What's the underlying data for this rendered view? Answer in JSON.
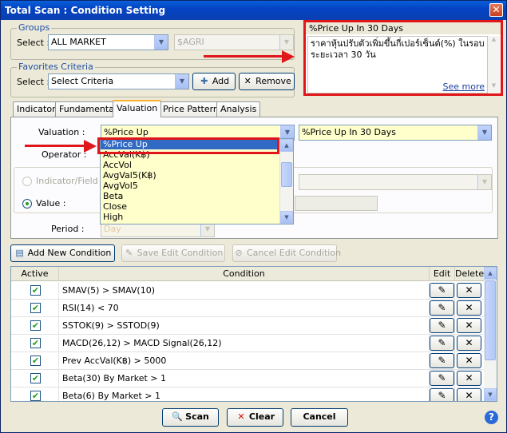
{
  "window": {
    "title": "Total Scan : Condition Setting",
    "close_glyph": "✕"
  },
  "groups": {
    "legend": "Groups",
    "select_label": "Select :",
    "market_value": "ALL MARKET",
    "sector_value": "$AGRI"
  },
  "favorites": {
    "legend": "Favorites Criteria",
    "select_label": "Select :",
    "criteria_value": "Select Criteria",
    "add_label": "Add",
    "remove_label": "Remove"
  },
  "description": {
    "title": "%Price Up In 30 Days",
    "text": "ราคาหุ้นปรับตัวเพิ่มขึ้นกี่เปอร์เซ็นต์(%) ในรอบระยะเวลา 30 วัน",
    "see_more": "See more"
  },
  "tabs": [
    "Indicator",
    "Fundamental",
    "Valuation",
    "Price Pattern",
    "Analysis"
  ],
  "valuation_panel": {
    "valuation_label": "Valuation :",
    "valuation_value": "%Price Up",
    "period_combo_value": "%Price Up In 30 Days",
    "operator_label": "Operator :",
    "indicator_field_label": "Indicator/Field :",
    "value_label": "Value :",
    "period_label": "Period :",
    "period_value": "Day",
    "dropdown_options": [
      "%Price Up",
      "AccVal(K฿)",
      "AccVol",
      "AvgVal5(K฿)",
      "AvgVol5",
      "Beta",
      "Close",
      "High"
    ],
    "selected_option": "%Price Up"
  },
  "actions": {
    "add_new_condition": "Add New Condition",
    "save_edit_condition": "Save Edit Condition",
    "cancel_edit_condition": "Cancel Edit Condition"
  },
  "grid": {
    "columns": [
      "Active",
      "Condition",
      "Edit",
      "Delete"
    ],
    "rows": [
      {
        "active": true,
        "condition": "SMAV(5) > SMAV(10)"
      },
      {
        "active": true,
        "condition": "RSI(14) < 70"
      },
      {
        "active": true,
        "condition": "SSTOK(9) > SSTOD(9)"
      },
      {
        "active": true,
        "condition": "MACD(26,12) > MACD Signal(26,12)"
      },
      {
        "active": true,
        "condition": "Prev AccVal(K฿) > 5000"
      },
      {
        "active": true,
        "condition": "Beta(30) By Market > 1"
      },
      {
        "active": true,
        "condition": "Beta(6) By Market > 1"
      }
    ]
  },
  "footer": {
    "scan_label": "Scan",
    "clear_label": "Clear",
    "cancel_label": "Cancel",
    "help_glyph": "?"
  },
  "colors": {
    "highlight_red": "#e0161b",
    "title_blue": "#0a4fd0",
    "selection_blue": "#316ac5",
    "input_yellow": "#ffffcc"
  }
}
